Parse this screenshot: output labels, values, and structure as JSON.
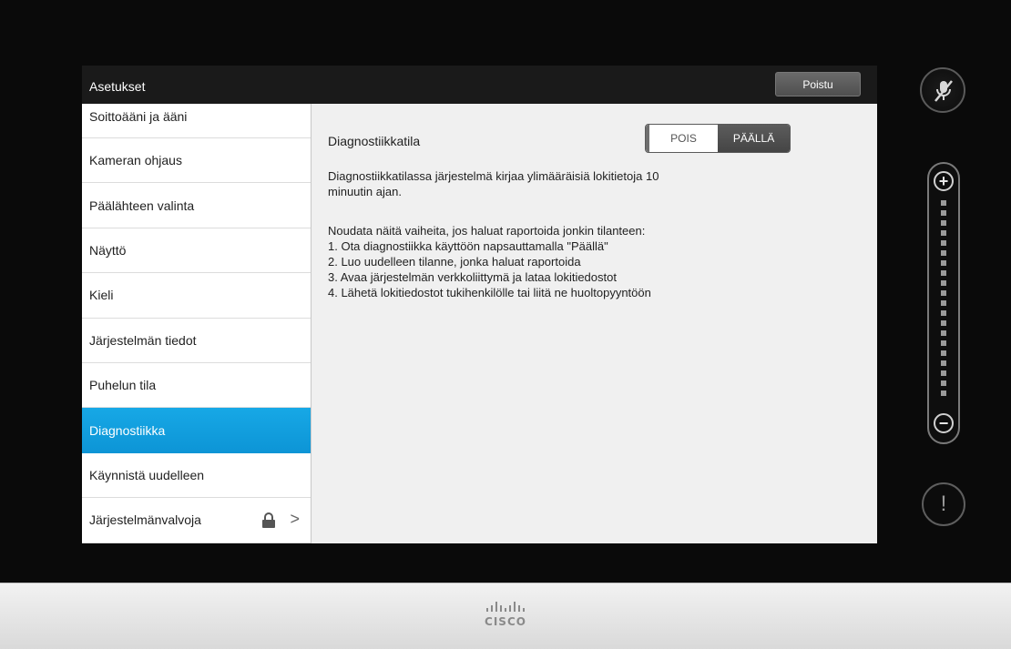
{
  "window": {
    "title": "Asetukset",
    "exit_label": "Poistu"
  },
  "sidebar": {
    "items": [
      {
        "label": "Soittoääni ja ääni"
      },
      {
        "label": "Kameran ohjaus"
      },
      {
        "label": "Päälähteen valinta"
      },
      {
        "label": "Näyttö"
      },
      {
        "label": "Kieli"
      },
      {
        "label": "Järjestelmän tiedot"
      },
      {
        "label": "Puhelun tila"
      },
      {
        "label": "Diagnostiikka",
        "active": true
      },
      {
        "label": "Käynnistä uudelleen"
      },
      {
        "label": "Järjestelmänvalvoja",
        "locked": true,
        "chevron": ">"
      }
    ]
  },
  "content": {
    "setting_label": "Diagnostiikkatila",
    "toggle": {
      "off_label": "POIS",
      "on_label": "PÄÄLLÄ",
      "selected": "PÄÄLLÄ"
    },
    "description_line1": "Diagnostiikkatilassa järjestelmä kirjaa ylimääräisiä lokitietoja 10",
    "description_line2": "minuutin ajan.",
    "instructions_intro": "Noudata näitä vaiheita, jos haluat raportoida jonkin tilanteen:",
    "steps": [
      "1. Ota diagnostiikka käyttöön napsauttamalla \"Päällä\"",
      "2. Luo uudelleen tilanne, jonka haluat raportoida",
      "3. Avaa järjestelmän verkkoliittymä ja lataa lokitiedostot",
      "4. Lähetä lokitiedostot tukihenkilölle tai liitä ne huoltopyyntöön"
    ]
  },
  "controls": {
    "mute_icon": "microphone-muted-icon",
    "volume_plus": "+",
    "volume_minus": "−",
    "alert_symbol": "!"
  },
  "branding": {
    "logo_text": "CISCO"
  },
  "colors": {
    "accent": "#0d95d6",
    "header_bg": "#1a1a1a"
  }
}
